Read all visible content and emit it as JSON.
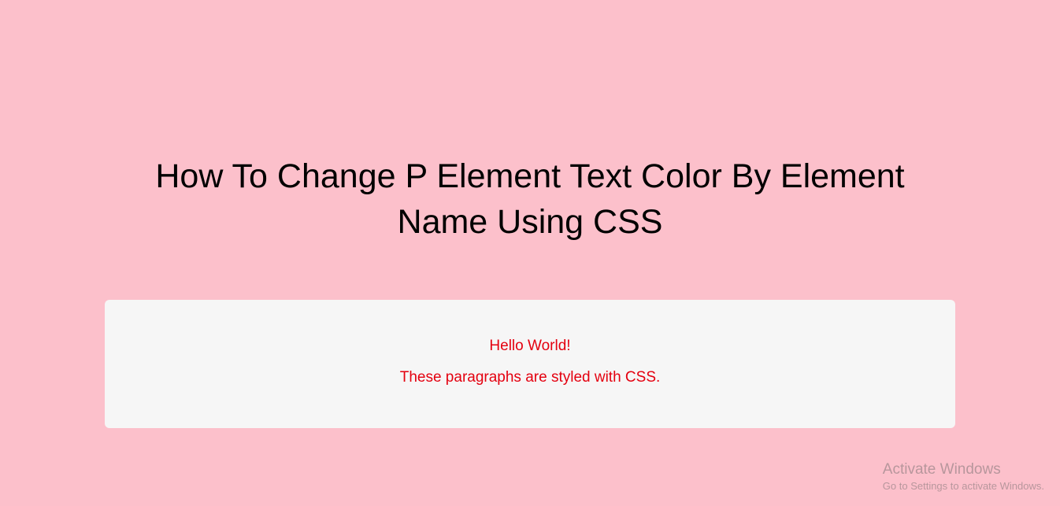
{
  "heading": "How To Change P Element Text Color By Element Name Using CSS",
  "paragraphs": {
    "first": "Hello World!",
    "second": "These paragraphs are styled with CSS."
  },
  "watermark": {
    "title": "Activate Windows",
    "subtitle": "Go to Settings to activate Windows."
  }
}
